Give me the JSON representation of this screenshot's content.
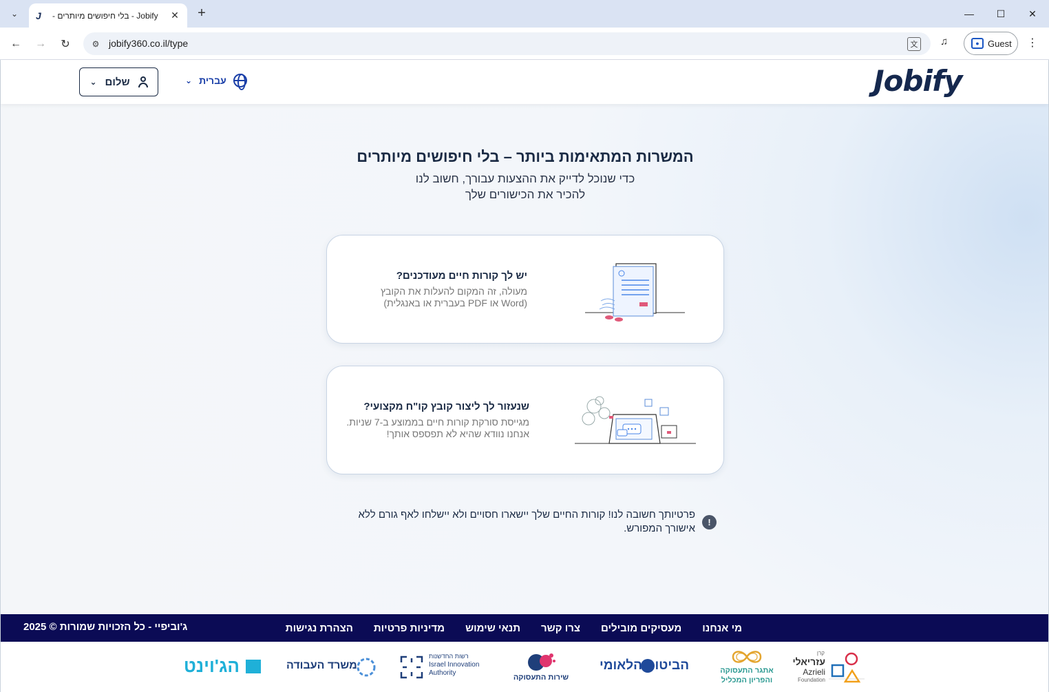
{
  "browser": {
    "tab_title": "Jobify - בלי חיפושים מיותרים - ",
    "tab_favicon": "J",
    "url": "jobify360.co.il/type",
    "profile_label": "Guest"
  },
  "header": {
    "logo": "Jobify",
    "language": "עברית",
    "user_label": "שלום"
  },
  "main": {
    "title": "המשרות המתאימות ביותר – בלי חיפושים מיותרים",
    "subtitle_line1": "כדי שנוכל לדייק את ההצעות עבורך, חשוב לנו",
    "subtitle_line2": "להכיר את הכישורים שלך",
    "cards": [
      {
        "title": "יש לך קורות חיים מעודכנים?",
        "desc_line1": "מעולה, זה המקום להעלות את הקובץ",
        "desc_line2": "(Word או PDF בעברית או באנגלית)"
      },
      {
        "title": "שנעזור לך ליצור קובץ קו\"ח מקצועי?",
        "desc_line1": "מגייסת סורקת קורות חיים בממוצע ב-7 שניות.",
        "desc_line2": "אנחנו נוודא שהיא לא תפספס אותך!"
      }
    ],
    "privacy_text": "פרטיותך חשובה לנו! קורות החיים שלך יישארו חסויים ולא יישלחו לאף גורם ללא אישורך המפורש."
  },
  "footer": {
    "links": [
      "מי אנחנו",
      "מעסיקים מובילים",
      "צרו קשר",
      "תנאי שימוש",
      "מדיניות פרטיות",
      "הצהרת נגישות"
    ],
    "copyright": "ג'וביפיי - כל הזכויות שמורות © 2025",
    "partners": {
      "azrieli_small": "קרן",
      "azrieli_he": "עזריאלי",
      "azrieli_en": "Azrieli",
      "azrieli_en2": "Foundation",
      "employment_challenge_1": "אתגר התעסוקה",
      "employment_challenge_2": "והפריון המכליל",
      "national_insurance": "הביטוח הלאומי",
      "employment_service": "שירות התעסוקה",
      "innovation_he": "רשות החדשנות",
      "innovation_en1": "Israel Innovation",
      "innovation_en2": "Authority",
      "labor_ministry": "משרד העבודה",
      "joint": "הג'וינט"
    }
  },
  "colors": {
    "brand_navy": "#15284e",
    "footer_bg": "#0b0b55",
    "accent_blue": "#1a3fa8"
  },
  "icons": {
    "language": "globe-icon",
    "user": "user-icon",
    "privacy": "exclamation-icon"
  }
}
